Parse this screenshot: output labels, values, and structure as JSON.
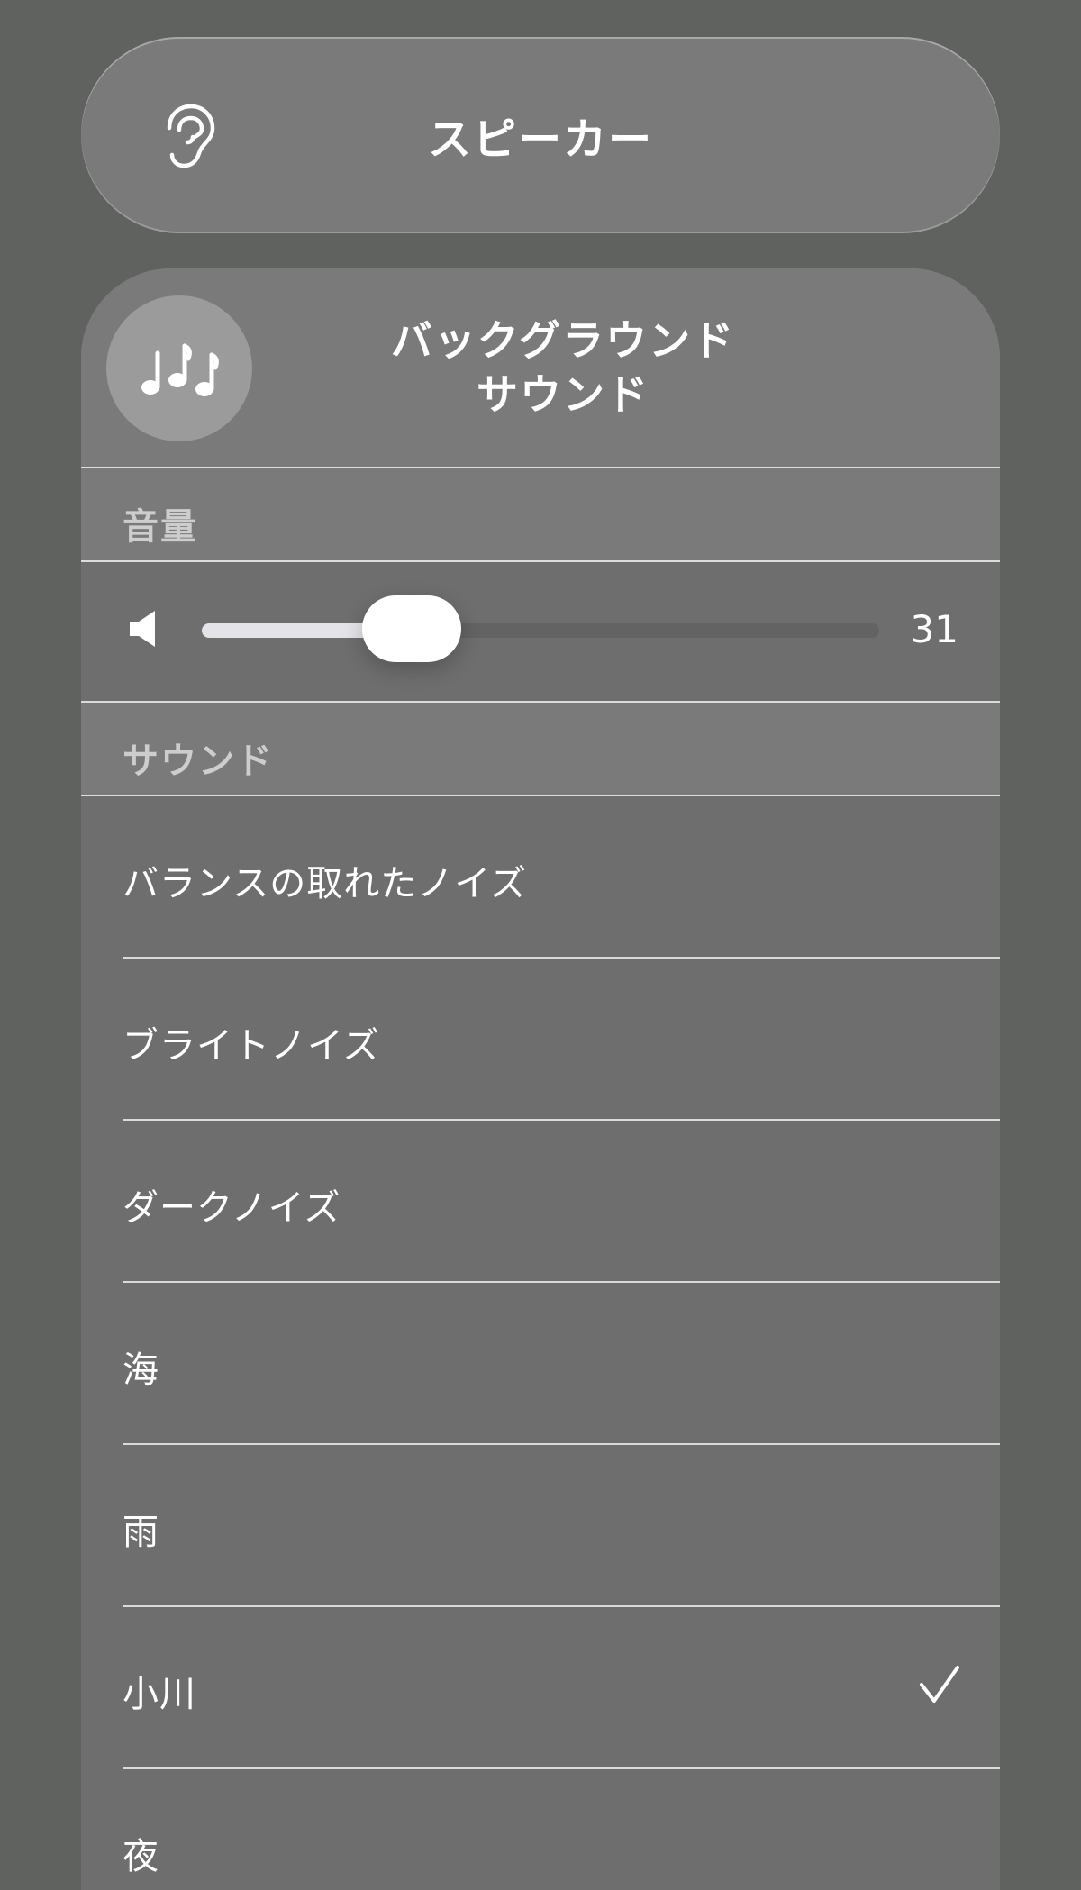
{
  "speaker": {
    "title": "スピーカー",
    "icon": "ear-icon"
  },
  "card": {
    "icon": "music-notes-icon",
    "title_line1": "バックグラウンド",
    "title_line2": "サウンド"
  },
  "volume": {
    "section_label": "音量",
    "icon": "speaker-icon",
    "value": "31",
    "level": 0.31
  },
  "sounds": {
    "section_label": "サウンド",
    "items": [
      {
        "label": "バランスの取れたノイズ",
        "selected": false
      },
      {
        "label": "ブライトノイズ",
        "selected": false
      },
      {
        "label": "ダークノイズ",
        "selected": false
      },
      {
        "label": "海",
        "selected": false
      },
      {
        "label": "雨",
        "selected": false
      },
      {
        "label": "小川",
        "selected": true
      },
      {
        "label": "夜",
        "selected": false
      }
    ],
    "selected_icon": "checkmark-icon"
  }
}
